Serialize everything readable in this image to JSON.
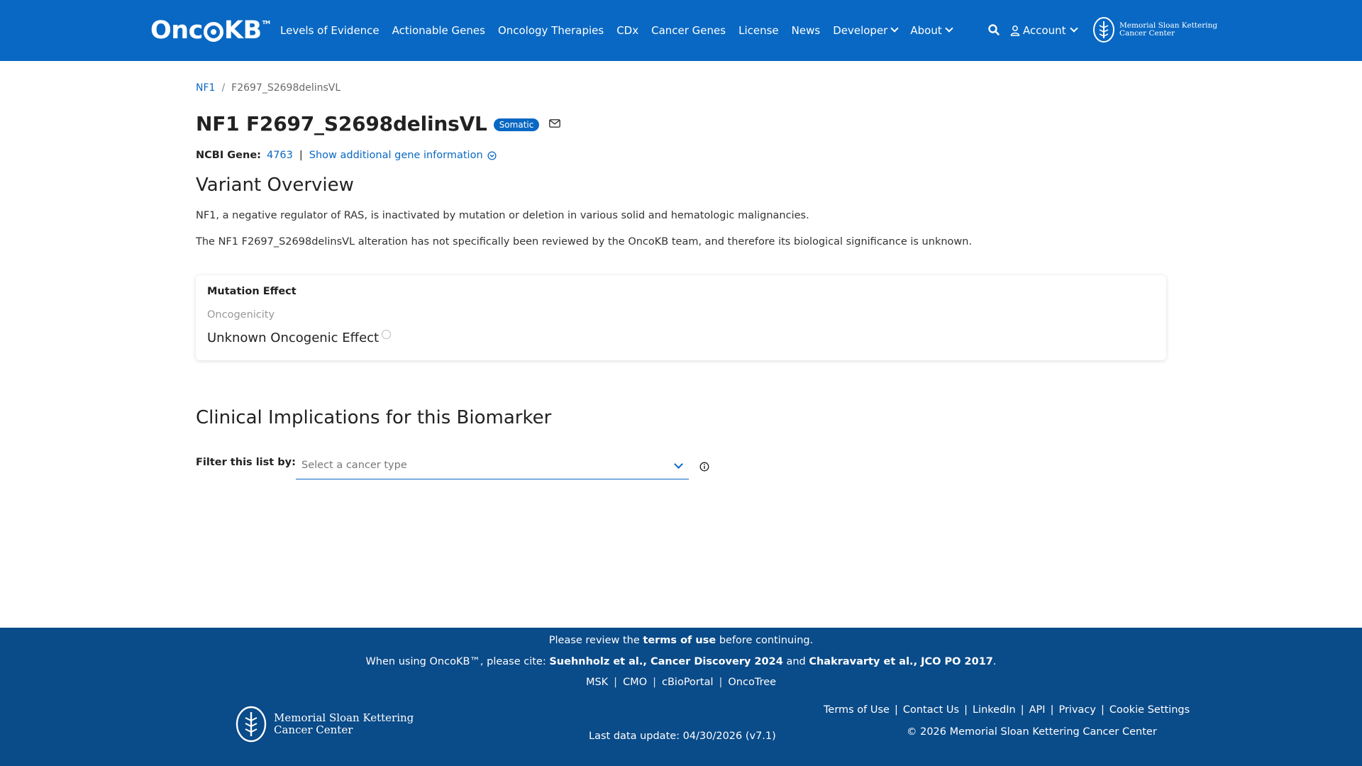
{
  "header": {
    "logo_text_before": "Onc",
    "logo_text_after": "KB",
    "logo_tm": "TM",
    "nav": [
      "Levels of Evidence",
      "Actionable Genes",
      "Oncology Therapies",
      "CDx",
      "Cancer Genes",
      "License",
      "News"
    ],
    "nav_dropdowns": [
      "Developer",
      "About"
    ],
    "account": "Account",
    "msk_line1": "Memorial Sloan Kettering",
    "msk_line2": "Cancer Center"
  },
  "colors": {
    "primary": "#0968c3",
    "footer_bg": "#0a4b89"
  },
  "breadcrumb": {
    "gene": "NF1",
    "sep": "/",
    "current": "F2697_S2698delinsVL"
  },
  "title": {
    "text": "NF1 F2697_S2698delinsVL",
    "badge": "Somatic"
  },
  "ncbi": {
    "label": "NCBI Gene:",
    "gene_id": "4763",
    "sep": "|",
    "more_link": "Show additional gene information"
  },
  "overview": {
    "heading": "Variant Overview",
    "p1": "NF1, a negative regulator of RAS, is inactivated by mutation or deletion in various solid and hematologic malignancies.",
    "p2": "The NF1 F2697_S2698delinsVL alteration has not specifically been reviewed by the OncoKB team, and therefore its biological significance is unknown."
  },
  "mutation_effect": {
    "title": "Mutation Effect",
    "sub": "Oncogenicity",
    "value": "Unknown Oncogenic Effect"
  },
  "clinical": {
    "heading": "Clinical Implications for this Biomarker",
    "filter_label": "Filter this list by:",
    "select_placeholder": "Select a cancer type"
  },
  "footer": {
    "review_before": "Please review the",
    "review_link": "terms of use",
    "review_after": "before continuing.",
    "cite_before": "When using OncoKB™, please cite:",
    "cite_1": "Suehnholz et al., Cancer Discovery 2024",
    "cite_and": "and",
    "cite_2": "Chakravarty et al., JCO PO 2017",
    "cite_end": ".",
    "partner_links": [
      "MSK",
      "CMO",
      "cBioPortal",
      "OncoTree"
    ],
    "sep": "|",
    "msk_line1": "Memorial Sloan Kettering",
    "msk_line2": "Cancer Center",
    "last_update": "Last data update: 04/30/2026 (v7.1)",
    "links": [
      "Terms of Use",
      "Contact Us",
      "LinkedIn",
      "API",
      "Privacy",
      "Cookie Settings"
    ],
    "copyright": "© 2026 Memorial Sloan Kettering Cancer Center"
  }
}
